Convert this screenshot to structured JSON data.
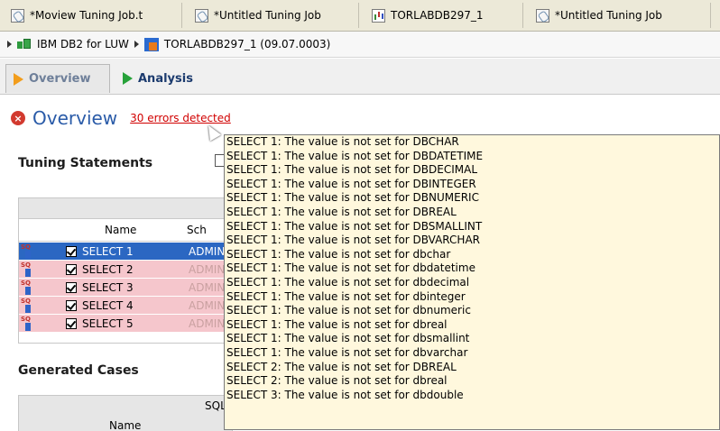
{
  "tabs": [
    {
      "label": "*Moview Tuning Job.t",
      "icon": "job-icon"
    },
    {
      "label": "*Untitled Tuning Job",
      "icon": "job-icon"
    },
    {
      "label": "TORLABDB297_1",
      "icon": "database-icon"
    },
    {
      "label": "*Untitled Tuning Job",
      "icon": "job-icon"
    }
  ],
  "breadcrumb": {
    "item1": "IBM DB2 for LUW",
    "item2": "TORLABDB297_1 (09.07.0003)"
  },
  "view_tabs": {
    "overview": "Overview",
    "analysis": "Analysis"
  },
  "overview": {
    "title": "Overview",
    "errors_link": "30 errors detected"
  },
  "tuning": {
    "title": "Tuning Statements",
    "columns": {
      "name": "Name",
      "schema": "Sch"
    },
    "rows": [
      {
        "name": "SELECT 1",
        "schema": "ADMIN",
        "selected": true
      },
      {
        "name": "SELECT 2",
        "schema": "ADMIN",
        "selected": false
      },
      {
        "name": "SELECT 3",
        "schema": "ADMIN",
        "selected": false
      },
      {
        "name": "SELECT 4",
        "schema": "ADMIN",
        "selected": false
      },
      {
        "name": "SELECT 5",
        "schema": "ADMIN",
        "selected": false
      }
    ]
  },
  "cases": {
    "title": "Generated Cases",
    "group_label": "SQL",
    "col_name": "Name"
  },
  "errors": [
    "SELECT 1: The value is not set for DBCHAR",
    "SELECT 1: The value is not set for DBDATETIME",
    "SELECT 1: The value is not set for DBDECIMAL",
    "SELECT 1: The value is not set for DBINTEGER",
    "SELECT 1: The value is not set for DBNUMERIC",
    "SELECT 1: The value is not set for DBREAL",
    "SELECT 1: The value is not set for DBSMALLINT",
    "SELECT 1: The value is not set for DBVARCHAR",
    "SELECT 1: The value is not set for dbchar",
    "SELECT 1: The value is not set for dbdatetime",
    "SELECT 1: The value is not set for dbdecimal",
    "SELECT 1: The value is not set for dbinteger",
    "SELECT 1: The value is not set for dbnumeric",
    "SELECT 1: The value is not set for dbreal",
    "SELECT 1: The value is not set for dbsmallint",
    "SELECT 1: The value is not set for dbvarchar",
    "SELECT 2: The value is not set for DBREAL",
    "SELECT 2: The value is not set for dbreal",
    "SELECT 3: The value is not set for dbdouble"
  ],
  "colors": {
    "selected_row": "#2b67c2",
    "error_row": "#f5c6cc",
    "popup_bg": "#fff8dd",
    "error_text": "#d10000"
  }
}
